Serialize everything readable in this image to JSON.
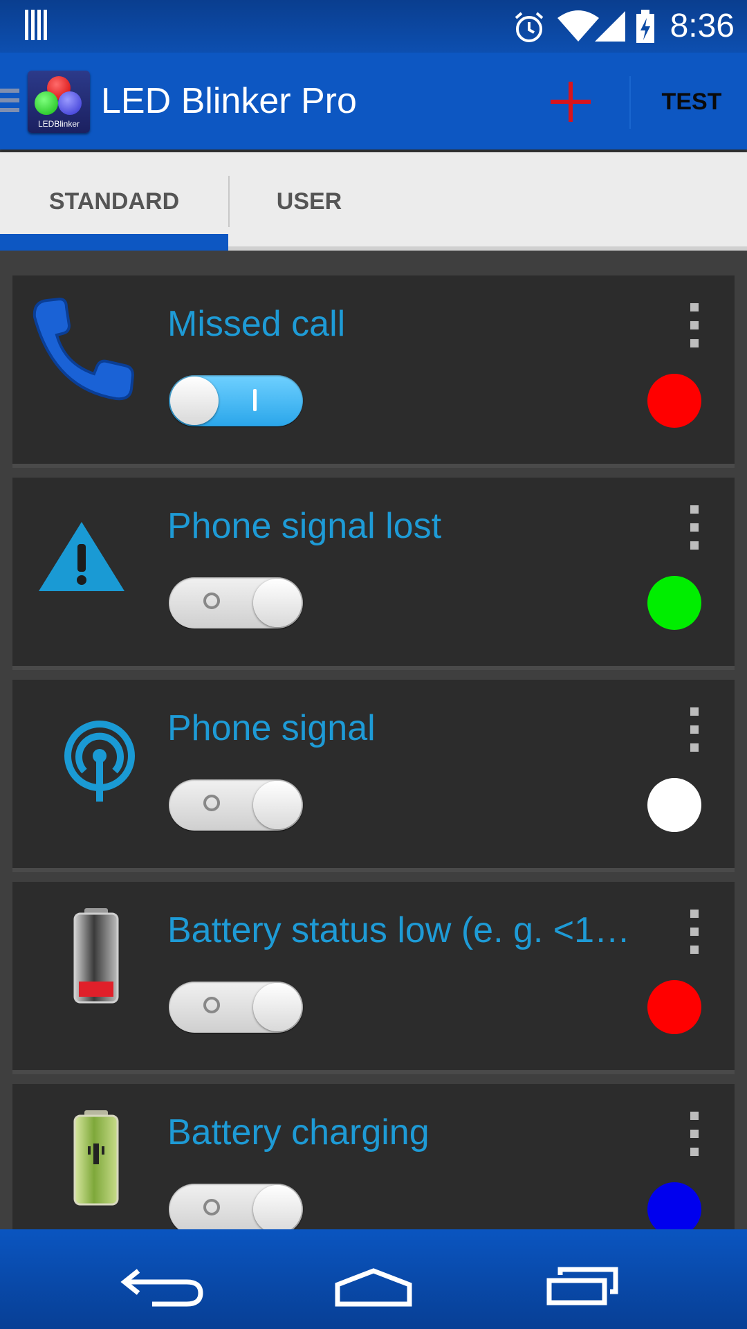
{
  "status_bar": {
    "time": "8:36",
    "icons": [
      "notification-bars-icon",
      "alarm-icon",
      "wifi-icon",
      "cell-signal-icon",
      "battery-charging-icon"
    ]
  },
  "app_bar": {
    "title": "LED Blinker Pro",
    "logo_text": "LEDBlinker",
    "add_icon": "plus-icon",
    "test_label": "TEST"
  },
  "tabs": [
    {
      "label": "STANDARD",
      "selected": true
    },
    {
      "label": "USER",
      "selected": false
    }
  ],
  "items": [
    {
      "title": "Missed call",
      "icon": "phone-icon",
      "enabled": true,
      "led_color": "#ff0000"
    },
    {
      "title": "Phone signal lost",
      "icon": "warning-icon",
      "enabled": false,
      "led_color": "#00ee00"
    },
    {
      "title": "Phone signal",
      "icon": "signal-broadcast-icon",
      "enabled": false,
      "led_color": "#ffffff"
    },
    {
      "title": "Battery status low (e. g. <1…",
      "icon": "battery-low-icon",
      "enabled": false,
      "led_color": "#ff0000"
    },
    {
      "title": "Battery charging",
      "icon": "battery-charging-icon",
      "enabled": false,
      "led_color": "#0000ee"
    }
  ],
  "nav_bar": {
    "buttons": [
      "back-icon",
      "home-icon",
      "recents-icon"
    ]
  },
  "colors": {
    "accent": "#0d57c2",
    "title_text": "#1e9bd6",
    "card_bg": "#2c2c2c"
  }
}
